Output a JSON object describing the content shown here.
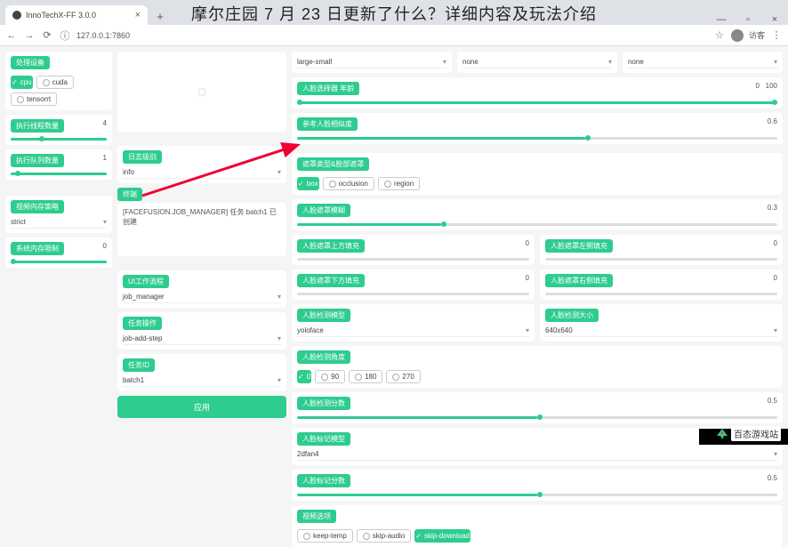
{
  "browser": {
    "tab_title": "InnoTechX-FF 3.0.0",
    "url": "127.0.0.1:7860",
    "user": "访客",
    "win_min": "—",
    "win_max": "▫",
    "win_close": "×"
  },
  "overlay_title": "摩尔庄园 7 月 23 日更新了什么？详细内容及玩法介绍",
  "col1": {
    "device_label": "处理设备",
    "devices": [
      "cpu",
      "cuda",
      "tensorrt"
    ],
    "threads_label": "执行线程数量",
    "threads_val": "4",
    "queue_label": "执行队列数量",
    "queue_val": "1",
    "memory_label": "视频内存策略",
    "memory_val": "strict",
    "vram_label": "系统内存限制",
    "vram_val": "0"
  },
  "col2": {
    "preview_placeholder": "▢",
    "log_label": "日志级别",
    "log_val": "info",
    "output_label": "终端",
    "output_text": "[FACEFUSION.JOB_MANAGER] 任务 batch1 已创建",
    "ui_label": "UI工作流程",
    "ui_val": "job_manager",
    "step_label": "任务操作",
    "step_val": "job-add-step",
    "jobid_label": "任务ID",
    "jobid_val": "batch1",
    "apply": "应用"
  },
  "col3": {
    "size_options": [
      "large-small",
      "none",
      "none"
    ],
    "age_label": "人脸选择器 年龄",
    "age_min": "0",
    "age_max": "100",
    "ref_label": "参考人脸相似度",
    "ref_val": "0.6",
    "mask_label": "遮罩类型&脸部遮罩",
    "mask_opts": [
      "box",
      "occlusion",
      "region"
    ],
    "blur_label": "人脸遮罩模糊",
    "blur_val": "0.3",
    "padtop_label": "人脸遮罩上方填充",
    "padtop_val": "0",
    "padleft_label": "人脸遮罩左侧填充",
    "padleft_val": "0",
    "padbot_label": "人脸遮罩下方填充",
    "padbot_val": "0",
    "padright_label": "人脸遮罩右侧填充",
    "padright_val": "0",
    "detector_label": "人脸检测模型",
    "detector_val": "yoloface",
    "detect_size_label": "人脸检测大小",
    "detect_size_val": "640x640",
    "angle_label": "人脸检测角度",
    "angles": [
      "0",
      "90",
      "180",
      "270"
    ],
    "score_label": "人脸检测分数",
    "score_val": "0.5",
    "lm_label": "人脸标记模型",
    "lm_val": "2dfan4",
    "lm_score_label": "人脸标记分数",
    "lm_score_val": "0.5",
    "dl_label": "视频选项",
    "dl_opts": [
      "keep-temp",
      "skip-audio",
      "skip-download"
    ]
  },
  "brand": "百态游戏站"
}
